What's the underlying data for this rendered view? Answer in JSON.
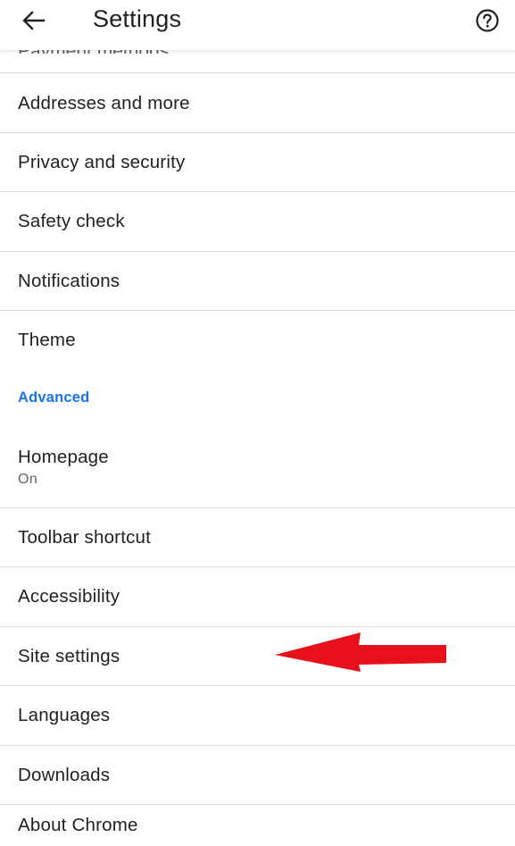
{
  "appbar": {
    "title": "Settings",
    "back_icon": "arrow-left-icon",
    "help_icon": "help-circle-icon"
  },
  "clipped_item_label": "Payment methods",
  "items_basic": [
    {
      "label": "Addresses and more"
    },
    {
      "label": "Privacy and security"
    },
    {
      "label": "Safety check"
    },
    {
      "label": "Notifications"
    },
    {
      "label": "Theme"
    }
  ],
  "advanced": {
    "header": "Advanced",
    "homepage": {
      "label": "Homepage",
      "status": "On"
    },
    "items": [
      {
        "label": "Toolbar shortcut"
      },
      {
        "label": "Accessibility"
      },
      {
        "label": "Site settings"
      },
      {
        "label": "Languages"
      },
      {
        "label": "Downloads"
      },
      {
        "label": "About Chrome"
      }
    ]
  },
  "colors": {
    "accent": "#1a73e8",
    "annotation_arrow": "#e8101a",
    "divider": "#dadce0",
    "text_primary": "#202124",
    "text_secondary": "#5f6368"
  }
}
